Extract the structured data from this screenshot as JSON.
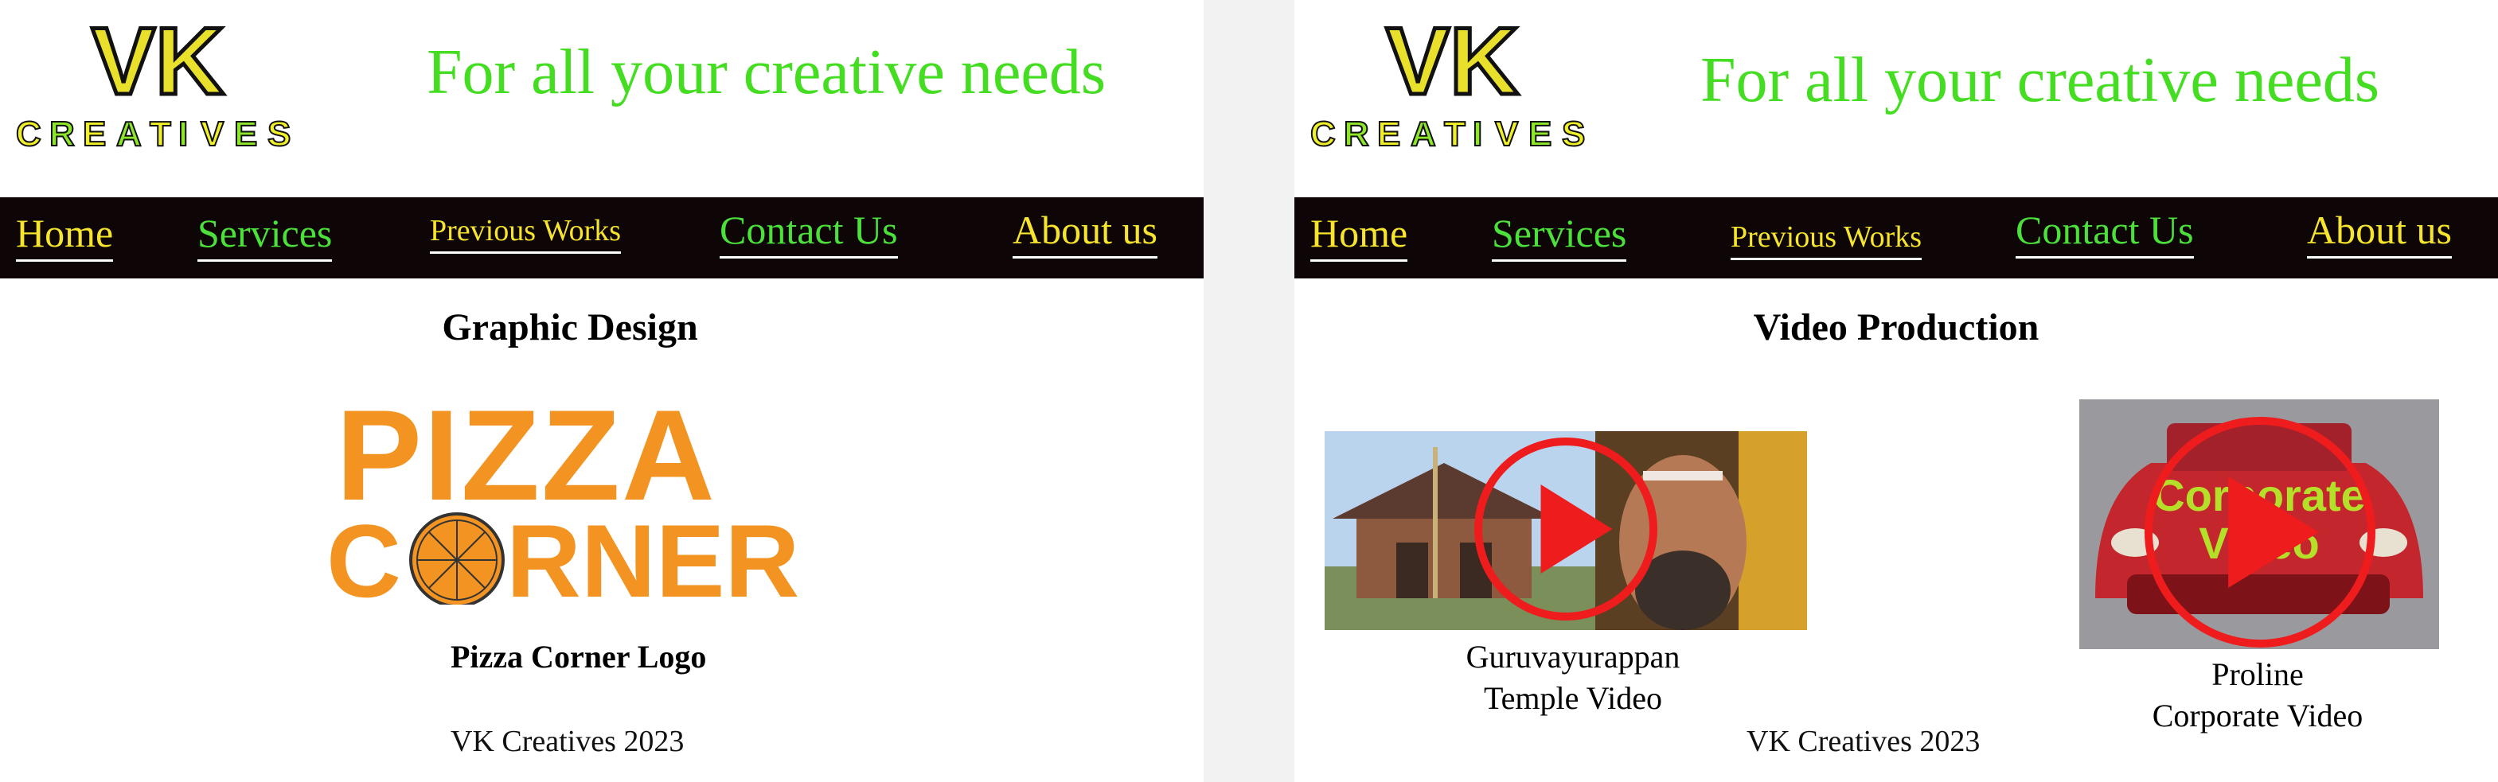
{
  "brand": {
    "logo_main": "VK",
    "logo_sub": [
      "C",
      "R",
      "E",
      "A",
      "T",
      "I",
      "V",
      "E",
      "S"
    ],
    "tagline": "For all your creative needs"
  },
  "nav": {
    "home": "Home",
    "services": "Services",
    "previous_works": "Previous Works",
    "contact": "Contact Us",
    "about": "About us"
  },
  "left_page": {
    "section_title": "Graphic Design",
    "pizza_logo_line1": "PIZZA",
    "pizza_logo_line2_start": "C",
    "pizza_logo_line2_end": "RNER",
    "caption": "Pizza Corner Logo",
    "footer": "VK Creatives 2023"
  },
  "right_page": {
    "section_title": "Video Production",
    "video1_caption_line1": "Guruvayurappan",
    "video1_caption_line2": "Temple Video",
    "video2_caption_line1": "Proline",
    "video2_caption_line2": "Corporate Video",
    "video2_overlay_line1": "Corporate",
    "video2_overlay_line2": "Video",
    "footer": "VK Creatives 2023"
  },
  "colors": {
    "nav_bg": "#0e0606",
    "tagline": "#44dd22",
    "yellow": "#f6e52c",
    "green": "#4ce13a",
    "pizza_orange": "#f39422",
    "play_red": "#ee1c1c"
  }
}
